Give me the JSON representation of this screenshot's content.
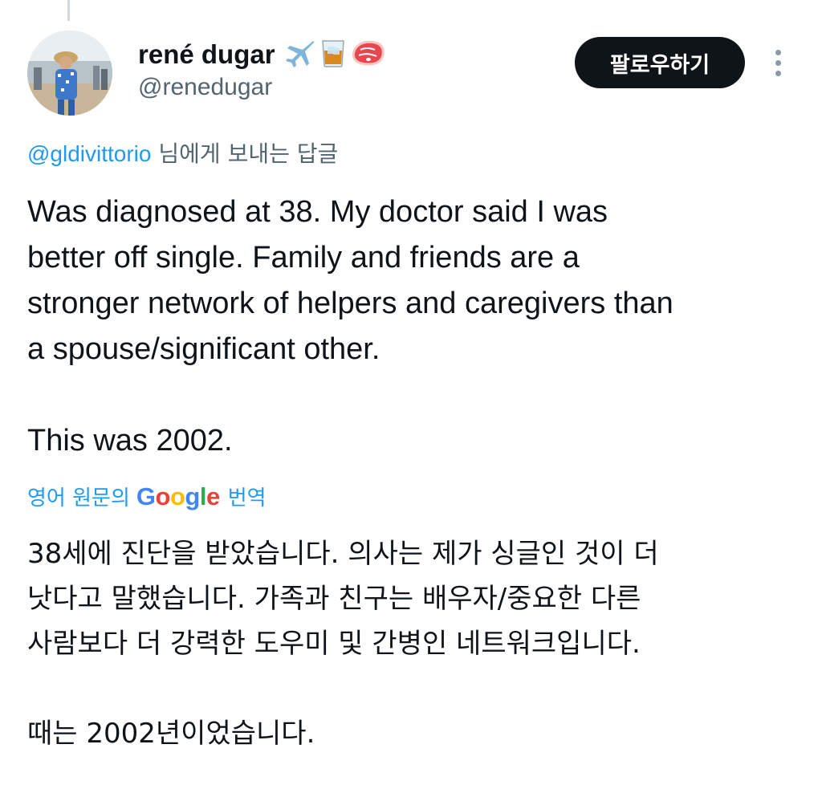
{
  "author": {
    "name": "rené dugar",
    "emoji": [
      "airplane-emoji",
      "whiskey-glass-emoji",
      "steak-emoji"
    ],
    "handle": "@renedugar"
  },
  "follow_button": {
    "label": "팔로우하기"
  },
  "more_menu": {
    "icon": "more-vertical-icon"
  },
  "reply_context": {
    "mention": "@gldivittorio",
    "suffix": " 님에게 보내는 답글"
  },
  "tweet": {
    "lines": [
      "Was diagnosed at 38. My doctor said I was",
      "better off single. Family and friends are a",
      "stronger network of helpers and caregivers than",
      "a spouse/significant other."
    ],
    "closing": "This was 2002."
  },
  "translation": {
    "prefix": "영어 원문의",
    "brand": "Google",
    "suffix": "번역",
    "brand_colors": [
      "#4285f4",
      "#ea4335",
      "#fbbc05",
      "#4285f4",
      "#34a853",
      "#ea4335"
    ],
    "lines": [
      "38세에 진단을 받았습니다. 의사는 제가 싱글인 것이 더",
      "낫다고 말했습니다. 가족과 친구는 배우자/중요한 다른",
      "사람보다 더 강력한 도우미 및 간병인 네트워크입니다."
    ],
    "closing": "때는 2002년이었습니다."
  },
  "colors": {
    "link": "#1d9bf0",
    "secondary_text": "#536471",
    "primary_text": "#0f1419",
    "button_bg": "#0f1419"
  }
}
